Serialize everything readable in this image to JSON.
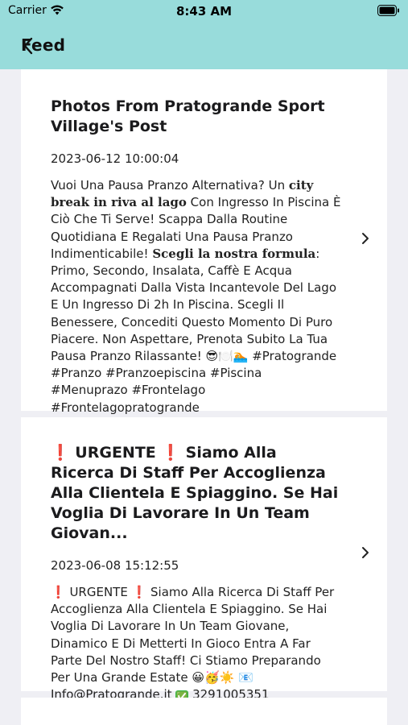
{
  "status_bar": {
    "carrier": "Carrier",
    "time": "8:43 AM"
  },
  "nav": {
    "title": "Feed",
    "back_icon": "back-arrow-icon"
  },
  "posts": [
    {
      "title": "Photos From Pratogrande Sport Village's Post",
      "date": "2023-06-12 10:00:04",
      "body_parts": [
        "Vuoi Una Pausa Pranzo Alternativa? Un ",
        "city break in riva al lago",
        " Con Ingresso In Piscina È Ciò Che Ti Serve! Scappa Dalla Routine Quotidiana E Regalati Una Pausa Pranzo Indimenticabile! ",
        "Scegli la nostra formula",
        ": Primo, Secondo, Insalata, Caffè E Acqua Accompagnati Dalla Vista Incantevole Del Lago E Un Ingresso Di 2h In Piscina. Scegli Il Benessere, Concediti Questo Momento Di Puro Piacere. Non Aspettare, Prenota Subito La Tua Pausa Pranzo Rilassante! 😎🍽️🏊 #Pratogrande #Pranzo #Pranzoepiscina #Piscina #Menuprazo #Frontelago #Frontelagopratogrande"
      ]
    },
    {
      "title": "❗ URGENTE ❗  Siamo Alla Ricerca Di Staff Per Accoglienza Alla Clientela E Spiaggino. Se Hai Voglia Di Lavorare In Un Team Giovan...",
      "date": "2023-06-08 15:12:55",
      "body_parts": [
        "❗ URGENTE ❗  Siamo Alla Ricerca Di Staff Per Accoglienza Alla Clientela E Spiaggino. Se Hai Voglia Di Lavorare In Un Team Giovane, Dinamico E Di Metterti In Gioco Entra A Far Parte Del Nostro Staff! Ci Stiamo Preparando Per Una Grande Estate 😀🥳☀️ 📧 Info@Pratogrande.it ",
        "✅",
        " 3291005351"
      ]
    }
  ]
}
